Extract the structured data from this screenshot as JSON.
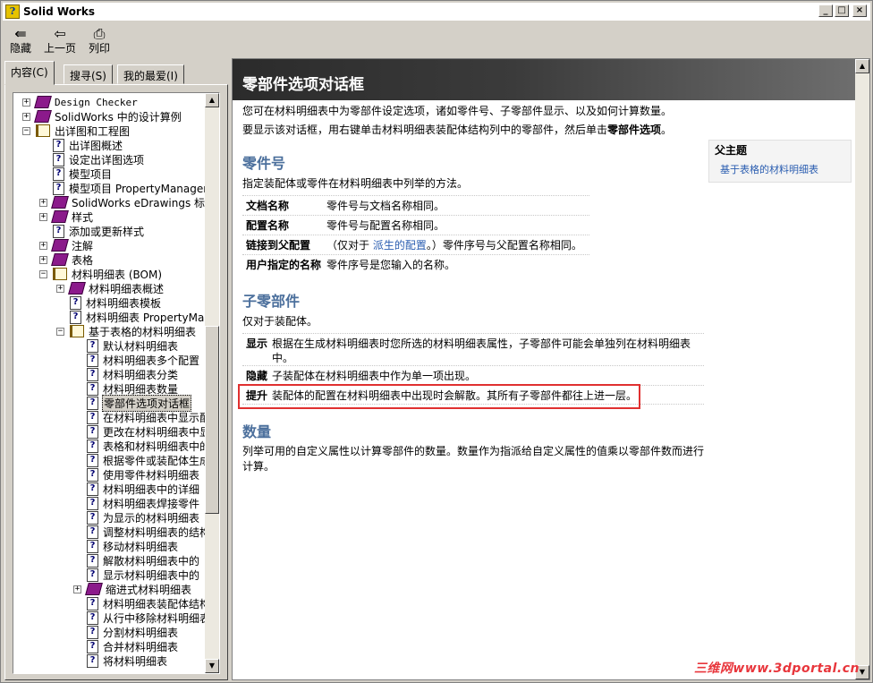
{
  "window": {
    "title": "Solid Works",
    "app_icon": "?",
    "controls": [
      "_",
      "□",
      "×"
    ]
  },
  "toolbar": {
    "hide_label": "隐藏",
    "back_label": "上一页",
    "print_label": "列印"
  },
  "tabs": {
    "contents": "内容(C)",
    "search": "搜寻(S)",
    "favorites": "我的最爱(I)"
  },
  "tree": [
    {
      "label": "Design Checker",
      "icon": "book",
      "exp": "+",
      "mono": true
    },
    {
      "label": "SolidWorks 中的设计算例",
      "icon": "book",
      "exp": "+"
    },
    {
      "label": "出详图和工程图",
      "icon": "open-book",
      "exp": "−"
    },
    {
      "label": "出详图概述",
      "icon": "page"
    },
    {
      "label": "设定出详图选项",
      "icon": "page"
    },
    {
      "label": "模型项目",
      "icon": "page"
    },
    {
      "label": "模型项目 PropertyManager",
      "icon": "page"
    },
    {
      "label": "SolidWorks eDrawings 标注",
      "icon": "book",
      "exp": "+"
    },
    {
      "label": "样式",
      "icon": "book",
      "exp": "+"
    },
    {
      "label": "添加或更新样式",
      "icon": "page"
    },
    {
      "label": "注解",
      "icon": "book",
      "exp": "+"
    },
    {
      "label": "表格",
      "icon": "book",
      "exp": "+"
    },
    {
      "label": "材料明细表 (BOM)",
      "icon": "open-book",
      "exp": "−"
    },
    {
      "label": "材料明细表概述",
      "icon": "book",
      "exp": "+"
    },
    {
      "label": "材料明细表模板",
      "icon": "page"
    },
    {
      "label": "材料明细表 PropertyManager",
      "icon": "page"
    },
    {
      "label": "基于表格的材料明细表",
      "icon": "open-book",
      "exp": "−"
    },
    {
      "label": "默认材料明细表",
      "icon": "page"
    },
    {
      "label": "材料明细表多个配置",
      "icon": "page"
    },
    {
      "label": "材料明细表分类",
      "icon": "page"
    },
    {
      "label": "材料明细表数量",
      "icon": "page"
    },
    {
      "label": "零部件选项对话框",
      "icon": "page",
      "selected": true
    },
    {
      "label": "在材料明细表中显示配置",
      "icon": "page"
    },
    {
      "label": "更改在材料明细表中显示",
      "icon": "page"
    },
    {
      "label": "表格和材料明细表中的",
      "icon": "page"
    },
    {
      "label": "根据零件或装配体生成",
      "icon": "page"
    },
    {
      "label": "使用零件材料明细表",
      "icon": "page"
    },
    {
      "label": "材料明细表中的详细",
      "icon": "page"
    },
    {
      "label": "材料明细表焊接零件",
      "icon": "page"
    },
    {
      "label": "为显示的材料明细表",
      "icon": "page"
    },
    {
      "label": "调整材料明细表的结构",
      "icon": "page"
    },
    {
      "label": "移动材料明细表",
      "icon": "page"
    },
    {
      "label": "解散材料明细表中的",
      "icon": "page"
    },
    {
      "label": "显示材料明细表中的",
      "icon": "page"
    },
    {
      "label": "缩进式材料明细表",
      "icon": "book",
      "exp": "+"
    },
    {
      "label": "材料明细表装配体结构",
      "icon": "page"
    },
    {
      "label": "从行中移除材料明细表",
      "icon": "page"
    },
    {
      "label": "分割材料明细表",
      "icon": "page"
    },
    {
      "label": "合并材料明细表",
      "icon": "page"
    },
    {
      "label": "将材料明细表",
      "icon": "page"
    }
  ],
  "topic": {
    "title": "零部件选项对话框",
    "intro1": "您可在材料明细表中为零部件设定选项，诸如零件号、子零部件显示、以及如何计算数量。",
    "intro2_pre": "要显示该对话框，用右键单击材料明细表装配体结构列中的零部件，然后单击",
    "intro2_bold": "零部件选项",
    "intro2_post": "。",
    "parent": {
      "title": "父主题",
      "link": "基于表格的材料明细表"
    },
    "part_no": {
      "heading": "零件号",
      "desc": "指定装配体或零件在材料明细表中列举的方法。",
      "rows": [
        {
          "k": "文档名称",
          "v": "零件号与文档名称相同。"
        },
        {
          "k": "配置名称",
          "v": "零件号与配置名称相同。"
        },
        {
          "k": "链接到父配置",
          "v_pre": "（仅对于 ",
          "v_link": "派生的配置",
          "v_post": "。）零件序号与父配置名称相同。"
        },
        {
          "k": "用户指定的名称",
          "v": "零件序号是您输入的名称。"
        }
      ]
    },
    "children": {
      "heading": "子零部件",
      "desc": "仅对于装配体。",
      "rows": [
        {
          "k": "显示",
          "v": "根据在生成材料明细表时您所选的材料明细表属性，子零部件可能会单独列在材料明细表中。"
        },
        {
          "k": "隐藏",
          "v": "子装配体在材料明细表中作为单一项出现。"
        },
        {
          "k": "提升",
          "v": "装配体的配置在材料明细表中出现时会解散。其所有子零部件都往上进一层。"
        }
      ]
    },
    "quantity": {
      "heading": "数量",
      "desc": "列举可用的自定义属性以计算零部件的数量。数量作为指派给自定义属性的值乘以零部件数而进行计算。"
    }
  },
  "watermark": "三维网www.3dportal.cn",
  "colors": {
    "heading": "#4b6f9c",
    "link": "#2a5db0",
    "highlight": "#e03030"
  }
}
